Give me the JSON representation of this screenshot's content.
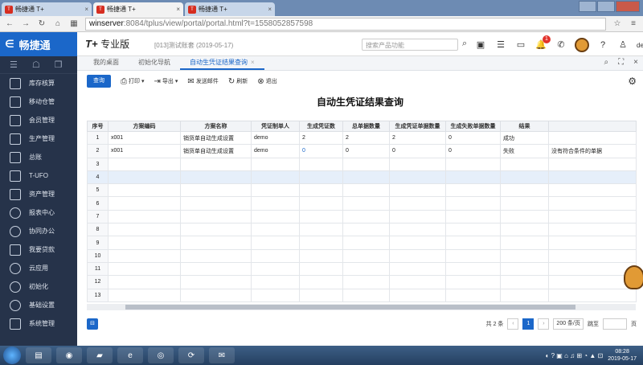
{
  "browser": {
    "tabs": [
      {
        "label": "畅捷通 T+",
        "active": false
      },
      {
        "label": "畅捷通 T+",
        "active": true
      },
      {
        "label": "畅捷通 T+",
        "active": false
      }
    ],
    "url_domain": "winserver",
    "url_rest": ":8084/tplus/view/portal/portal.html?t=1558052857598"
  },
  "header": {
    "brand": "畅捷通",
    "product": "T+",
    "edition": "专业版",
    "account": "[013]测试账套  (2019-05-17)",
    "search_placeholder": "搜索产品功能",
    "notification_count": "1",
    "user": "demo"
  },
  "sidebar": {
    "items": [
      {
        "label": "库存核算",
        "icon": "inventory-icon"
      },
      {
        "label": "移动仓管",
        "icon": "mobile-warehouse-icon"
      },
      {
        "label": "会员管理",
        "icon": "member-icon"
      },
      {
        "label": "生产管理",
        "icon": "production-icon"
      },
      {
        "label": "总账",
        "icon": "ledger-icon"
      },
      {
        "label": "T-UFO",
        "icon": "ufo-icon"
      },
      {
        "label": "资产管理",
        "icon": "asset-icon"
      },
      {
        "label": "报表中心",
        "icon": "report-icon"
      },
      {
        "label": "协同办公",
        "icon": "collaboration-icon"
      },
      {
        "label": "我要贷款",
        "icon": "loan-icon"
      },
      {
        "label": "云应用",
        "icon": "cloud-icon"
      },
      {
        "label": "初始化",
        "icon": "init-icon"
      },
      {
        "label": "基础设置",
        "icon": "settings-icon"
      },
      {
        "label": "系统管理",
        "icon": "system-icon"
      }
    ]
  },
  "pagetabs": [
    {
      "label": "我的桌面",
      "active": false
    },
    {
      "label": "初始化导航",
      "active": false
    },
    {
      "label": "自动生凭证结果查询",
      "active": true
    }
  ],
  "toolbar": {
    "query": "查询",
    "print": "打印",
    "export": "导出",
    "send_mail": "发送邮件",
    "refresh": "刷新",
    "exit": "退出"
  },
  "report": {
    "title": "自动生凭证结果查询",
    "columns": [
      "序号",
      "方案编码",
      "方案名称",
      "凭证制单人",
      "生成凭证数",
      "总单据数量",
      "生成凭证单据数量",
      "生成失败单据数量",
      "结果",
      ""
    ],
    "rows": [
      [
        "1",
        "x001",
        "销货单自动生成设置",
        "demo",
        "2",
        "2",
        "2",
        "0",
        "成功",
        ""
      ],
      [
        "2",
        "x001",
        "销货单自动生成设置",
        "demo",
        "0",
        "0",
        "0",
        "0",
        "失败",
        "没有符合条件的单据"
      ],
      [
        "3",
        "",
        "",
        "",
        "",
        "",
        "",
        "",
        "",
        ""
      ],
      [
        "4",
        "",
        "",
        "",
        "",
        "",
        "",
        "",
        "",
        ""
      ],
      [
        "5",
        "",
        "",
        "",
        "",
        "",
        "",
        "",
        "",
        ""
      ],
      [
        "6",
        "",
        "",
        "",
        "",
        "",
        "",
        "",
        "",
        ""
      ],
      [
        "7",
        "",
        "",
        "",
        "",
        "",
        "",
        "",
        "",
        ""
      ],
      [
        "8",
        "",
        "",
        "",
        "",
        "",
        "",
        "",
        "",
        ""
      ],
      [
        "9",
        "",
        "",
        "",
        "",
        "",
        "",
        "",
        "",
        ""
      ],
      [
        "10",
        "",
        "",
        "",
        "",
        "",
        "",
        "",
        "",
        ""
      ],
      [
        "11",
        "",
        "",
        "",
        "",
        "",
        "",
        "",
        "",
        ""
      ],
      [
        "12",
        "",
        "",
        "",
        "",
        "",
        "",
        "",
        "",
        ""
      ],
      [
        "13",
        "",
        "",
        "",
        "",
        "",
        "",
        "",
        "",
        ""
      ]
    ]
  },
  "pager": {
    "total": "共 2 条",
    "current_page": "1",
    "page_size": "200 条/页",
    "jump_label": "跳至",
    "page_suffix": "页"
  },
  "taskbar": {
    "time": "08:28",
    "date": "2019-05-17"
  },
  "colors": {
    "accent": "#1b67c9",
    "sidebar": "#26334a"
  }
}
